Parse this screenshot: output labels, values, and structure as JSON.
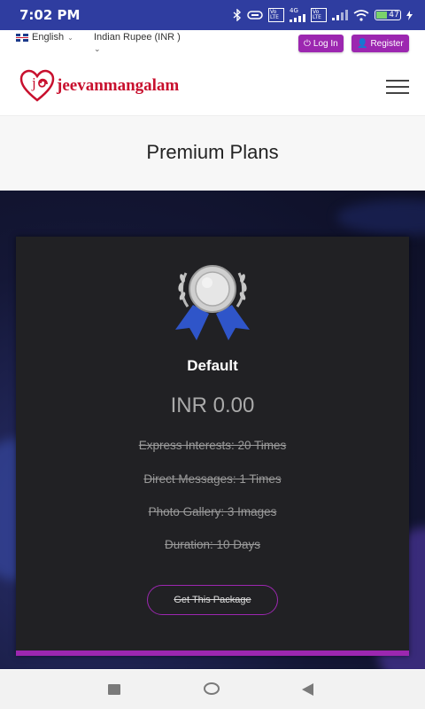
{
  "status_bar": {
    "time": "7:02 PM",
    "battery": "47",
    "network_label": "4G",
    "volte1": "Vo LTE",
    "volte2": "Vo LTE"
  },
  "utility_bar": {
    "language": "English",
    "currency": "Indian Rupee (INR )",
    "login_label": "Log In",
    "register_label": "Register"
  },
  "header": {
    "logo_text": "jeevanmangalam",
    "logo_initial": "j"
  },
  "page": {
    "title": "Premium Plans"
  },
  "plan": {
    "name": "Default",
    "price": "INR 0.00",
    "features": [
      "Express Interests: 20 Times",
      "Direct Messages: 1 Times",
      "Photo Gallery: 3 Images",
      "Duration: 10 Days"
    ],
    "cta_label": "Get This Package"
  },
  "colors": {
    "accent": "#9c27b0",
    "status_bar": "#2f3da0",
    "logo": "#c8102e",
    "card": "#212124"
  },
  "icons": {
    "bluetooth": "bluetooth-icon",
    "wifi": "wifi-icon",
    "battery": "battery-icon",
    "menu": "hamburger-menu-icon",
    "medal": "silver-medal-icon"
  }
}
